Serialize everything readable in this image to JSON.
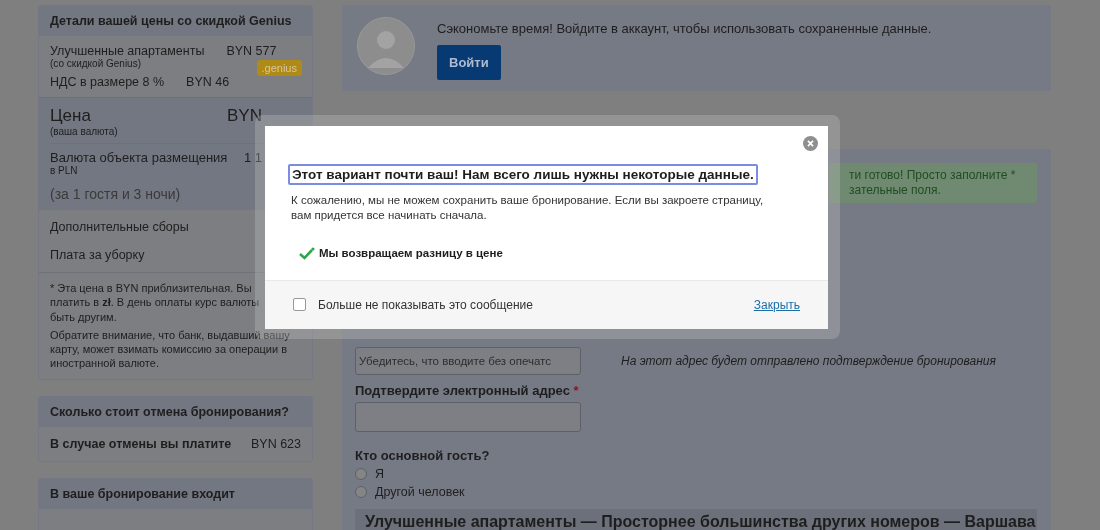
{
  "price_details": {
    "title": "Детали вашей цены со скидкой Genius",
    "badge": ".genius",
    "lines": [
      {
        "label": "Улучшенные апартаменты",
        "note": "(со скидкой Genius)",
        "amount": "BYN 577"
      },
      {
        "label": "НДС в размере 8 %",
        "amount": "BYN 46"
      }
    ],
    "total": {
      "label": "Цена",
      "note": "(ваша валюта)",
      "amount": "BYN"
    },
    "property_currency": {
      "label": "Валюта объекта размещения",
      "note": "в PLN",
      "amount": "1 1",
      "stay": "(за 1 гостя и 3 ночи)"
    },
    "extras": [
      "Дополнительные сборы",
      "Плата за уборку"
    ],
    "footnote_lines": [
      "*  Эта цена в BYN приблизительная. Вы",
      "платить в **zł**. В день оплаты курс валюты",
      "быть другим."
    ],
    "bank_note": "Обратите внимание, что банк, выдавший вашу карту, может взимать комиссию за операции в иностранной валюте."
  },
  "cancellation": {
    "title": "Сколько стоит отмена бронирования?",
    "label": "В случае отмены вы платите",
    "amount": "BYN 623"
  },
  "included": {
    "title": "В ваше бронирование входит"
  },
  "login": {
    "text": "Сэкономьте время! Войдите в аккаунт, чтобы использовать сохраненные данные.",
    "button": "Войти"
  },
  "notice_lines": [
    "ти готово! Просто заполните *",
    "зательные поля."
  ],
  "form": {
    "email": {
      "placeholder": "Убедитесь, что вводите без опечатс",
      "hint": "На этот адрес будет отправлено подтверждение бронирования"
    },
    "confirm_email": {
      "label": "Подтвердите электронный адрес",
      "required": true,
      "required_mark": "*"
    },
    "main_guest": {
      "label": "Кто основной гость?",
      "options": [
        {
          "label": "Я",
          "selected": false
        },
        {
          "label": "Другой человек",
          "selected": false
        }
      ]
    }
  },
  "room_title": "Улучшенные апартаменты — Просторнее большинства других номеров — Варшава",
  "modal": {
    "title": "Этот вариант почти ваш! Нам всего лишь нужны некоторые данные.",
    "text": "К сожалению, мы не можем сохранить ваше бронирование. Если вы закроете страницу, вам придется все начинать сначала.",
    "benefit": "Мы возвращаем разницу в цене",
    "dont_show": {
      "label": "Больше не показывать это сообщение",
      "checked": false
    },
    "close_link": "Закрыть"
  }
}
